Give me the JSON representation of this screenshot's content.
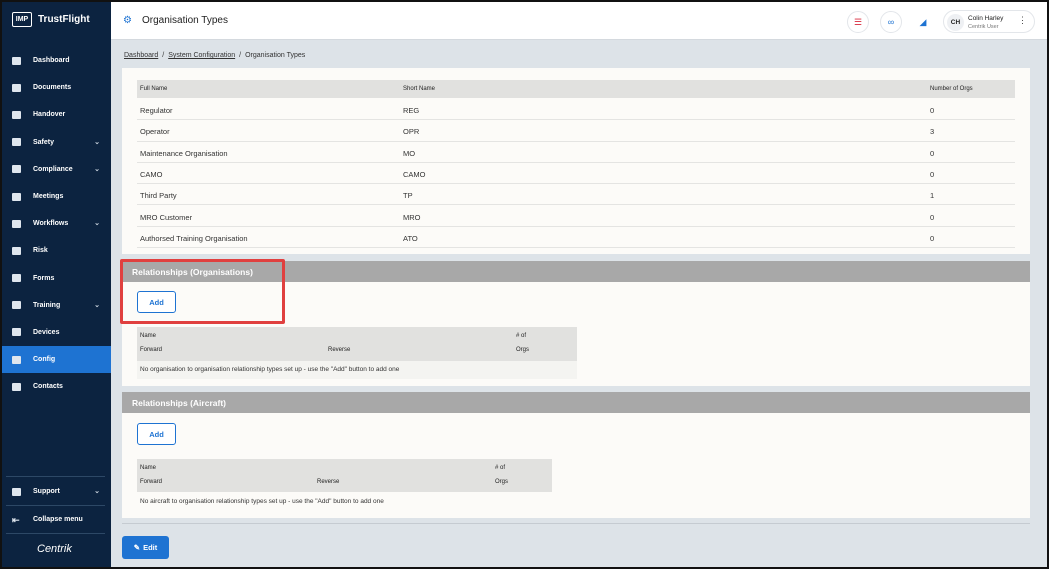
{
  "sidebar": {
    "logo": "IMP",
    "brand": "TrustFlight",
    "items": [
      {
        "label": "Dashboard",
        "icon": "dashboard-icon",
        "chevron": false
      },
      {
        "label": "Documents",
        "icon": "paperclip-icon",
        "chevron": false
      },
      {
        "label": "Handover",
        "icon": "handover-icon",
        "chevron": false
      },
      {
        "label": "Safety",
        "icon": "shield-icon",
        "chevron": true
      },
      {
        "label": "Compliance",
        "icon": "compliance-icon",
        "chevron": true
      },
      {
        "label": "Meetings",
        "icon": "meetings-icon",
        "chevron": false
      },
      {
        "label": "Workflows",
        "icon": "workflows-icon",
        "chevron": true
      },
      {
        "label": "Risk",
        "icon": "risk-icon",
        "chevron": false
      },
      {
        "label": "Forms",
        "icon": "forms-icon",
        "chevron": false
      },
      {
        "label": "Training",
        "icon": "graduation-cap-icon",
        "chevron": true
      },
      {
        "label": "Devices",
        "icon": "devices-icon",
        "chevron": false
      },
      {
        "label": "Config",
        "icon": "config-icon",
        "chevron": false,
        "active": true
      },
      {
        "label": "Contacts",
        "icon": "contacts-icon",
        "chevron": false
      }
    ],
    "support": "Support",
    "collapse": "Collapse menu",
    "footer_brand": "Centrik"
  },
  "header": {
    "title": "Organisation Types",
    "user_initials": "CH",
    "user_name": "Colin Harley",
    "user_role": "Centrik User"
  },
  "breadcrumb": {
    "items": [
      "Dashboard",
      "System Configuration"
    ],
    "current": "Organisation Types"
  },
  "org_types": {
    "columns": [
      "Full Name",
      "Short Name",
      "Number of Orgs"
    ],
    "rows": [
      [
        "Regulator",
        "REG",
        "0"
      ],
      [
        "Operator",
        "OPR",
        "3"
      ],
      [
        "Maintenance Organisation",
        "MO",
        "0"
      ],
      [
        "CAMO",
        "CAMO",
        "0"
      ],
      [
        "Third Party",
        "TP",
        "1"
      ],
      [
        "MRO Customer",
        "MRO",
        "0"
      ],
      [
        "Authorsed Training Organisation",
        "ATO",
        "0"
      ]
    ]
  },
  "rel_orgs": {
    "title": "Relationships (Organisations)",
    "add_label": "Add",
    "col_name": "Name",
    "col_forward": "Forward",
    "col_reverse": "Reverse",
    "col_count_1": "# of",
    "col_count_2": "Orgs",
    "empty": "No organisation to organisation relationship types set up - use the \"Add\" button to add one"
  },
  "rel_aircraft": {
    "title": "Relationships (Aircraft)",
    "add_label": "Add",
    "col_name": "Name",
    "col_forward": "Forward",
    "col_reverse": "Reverse",
    "col_count_1": "# of",
    "col_count_2": "Orgs",
    "empty": "No aircraft to organisation relationship types set up - use the \"Add\" button to add one"
  },
  "edit_label": "Edit",
  "colors": {
    "sidebar_bg": "#0c2340",
    "accent": "#1e73d2",
    "highlight": "#e0403f",
    "section_bar": "#a8a8a8"
  }
}
